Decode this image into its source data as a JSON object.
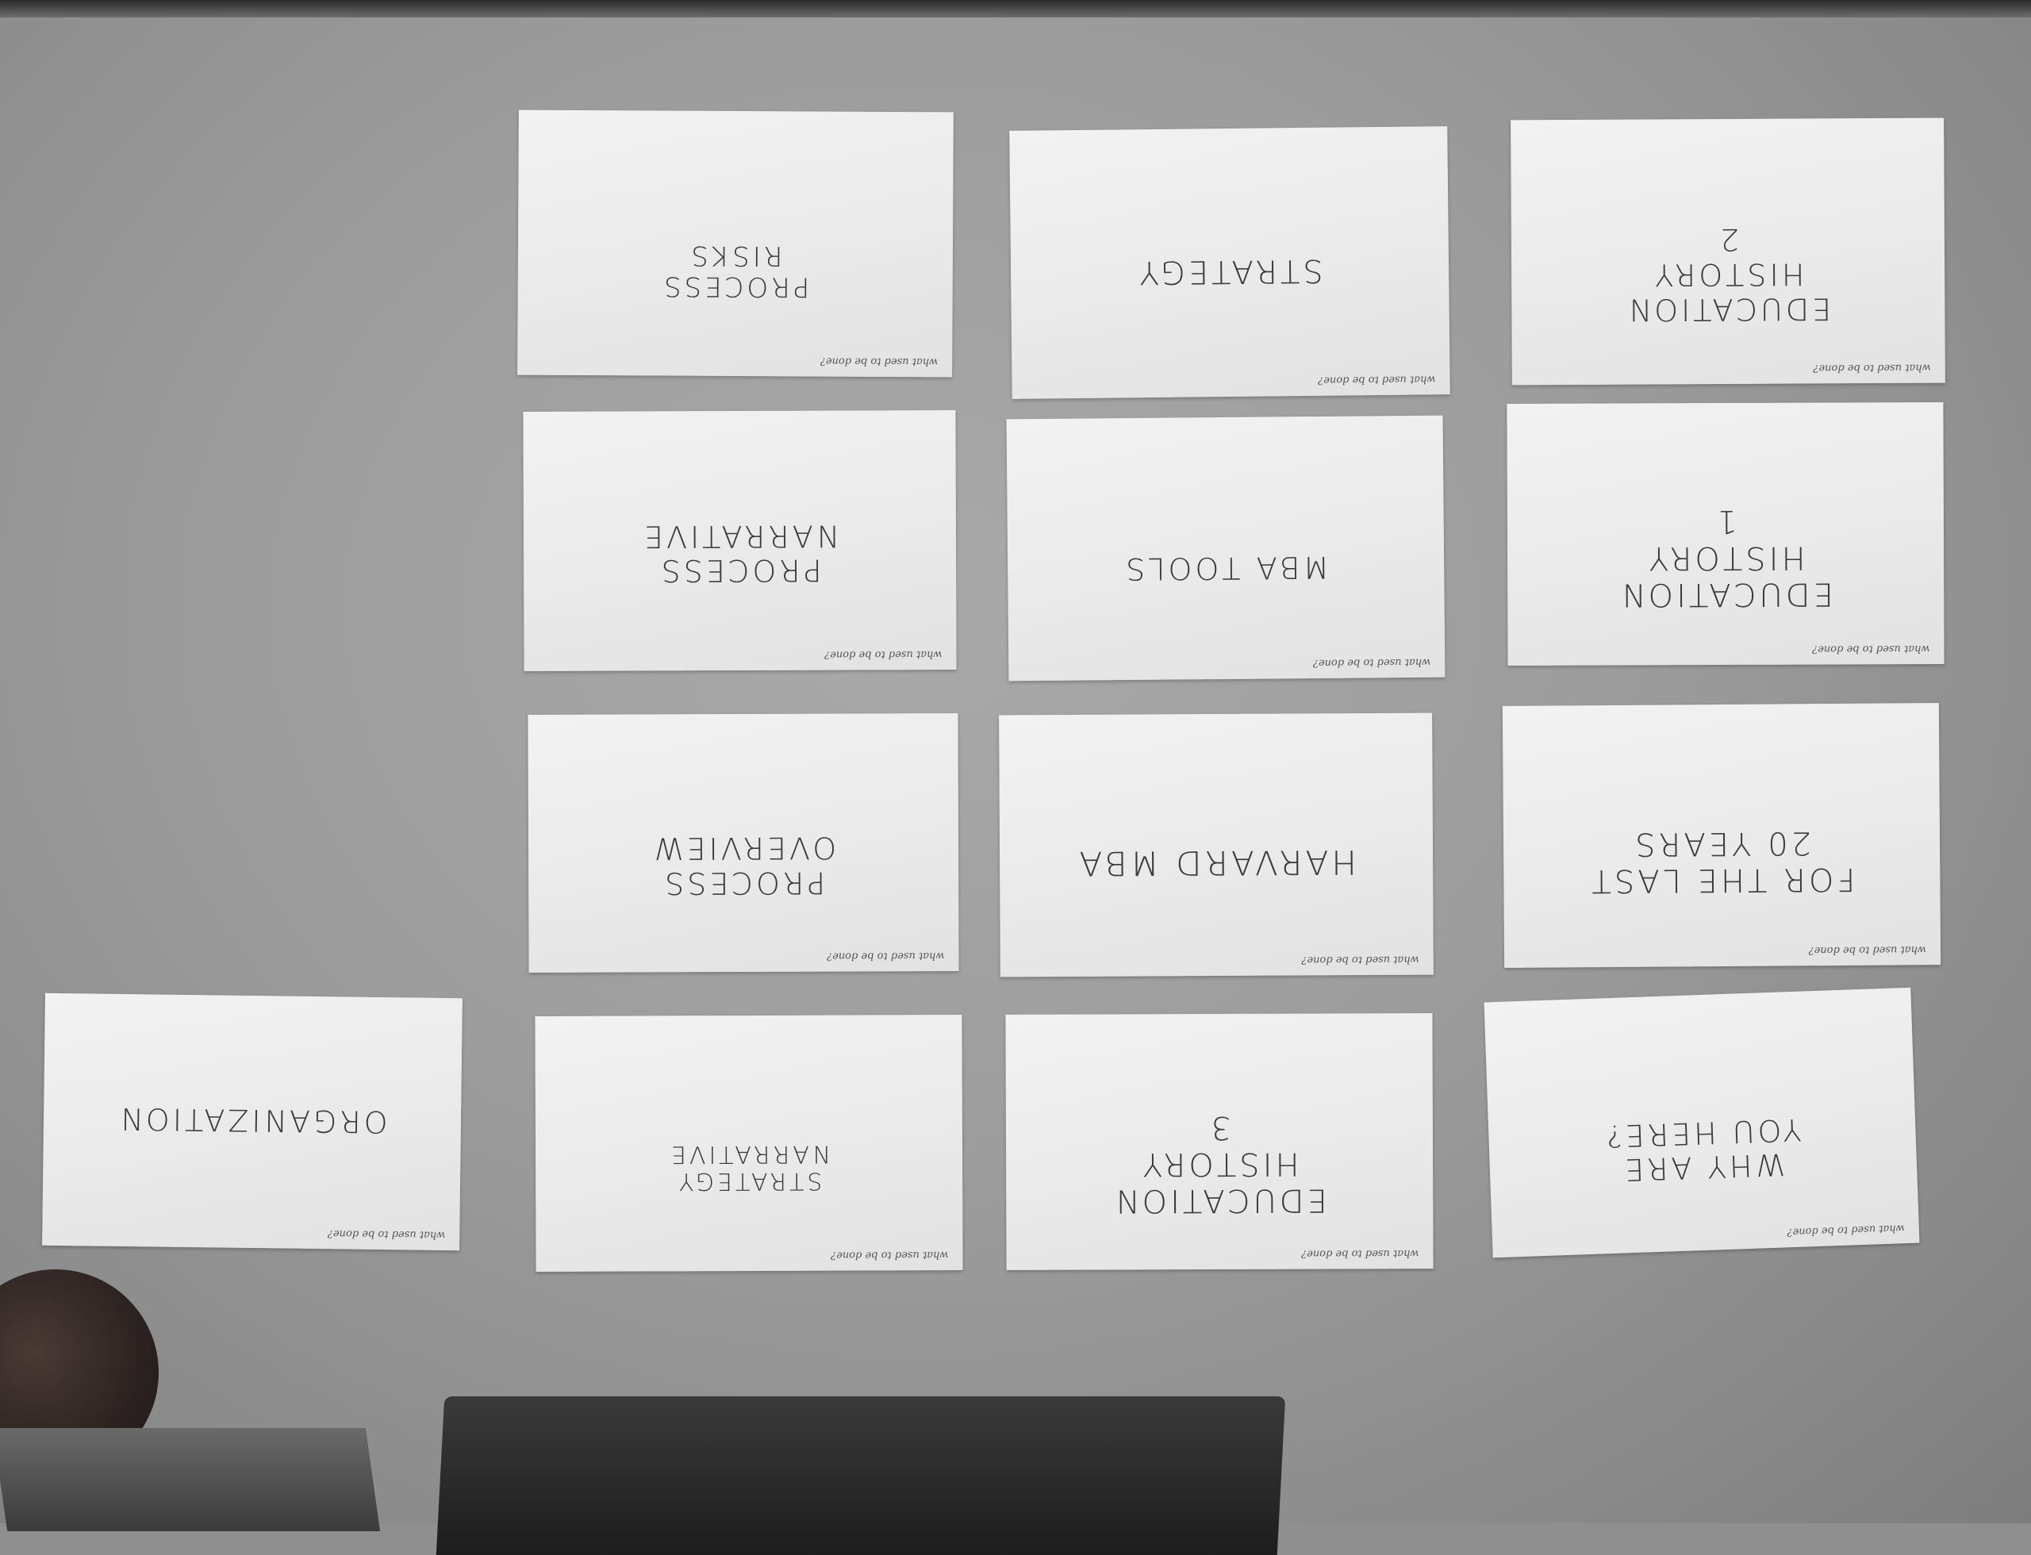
{
  "prompt": "what used to be done?",
  "cards": [
    {
      "title": "PROCESS\nRISKS"
    },
    {
      "title": "STRATEGY"
    },
    {
      "title": "EDUCATION\nHISTORY\n2"
    },
    {
      "title": "PROCESS\nNARRATIVE"
    },
    {
      "title": "MBA TOOLS"
    },
    {
      "title": "EDUCATION\nHISTORY\n1"
    },
    {
      "title": "PROCESS\nOVERVIEW"
    },
    {
      "title": "HARVARD MBA"
    },
    {
      "title": "FOR THE LAST\n20 YEARS"
    },
    {
      "title": "ORGANIZATION"
    },
    {
      "title": "STRATEGY\nNARRATIVE"
    },
    {
      "title": "EDUCATION\nHISTORY\n3"
    },
    {
      "title": "WHY ARE\nYOU HERE?"
    }
  ]
}
